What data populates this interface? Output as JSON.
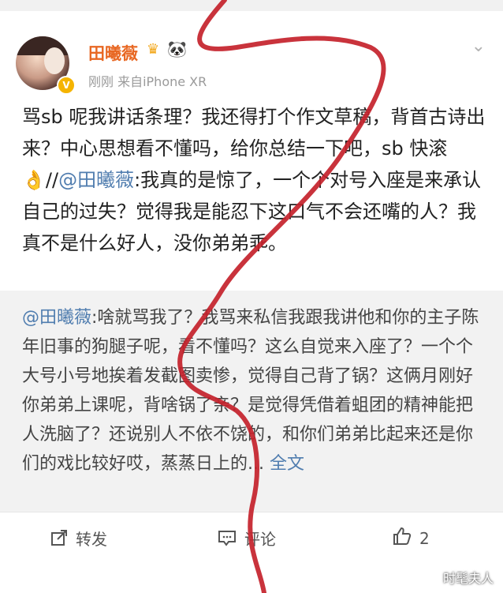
{
  "post": {
    "username": "田曦薇",
    "crown_icon": "crown-icon",
    "panda_icon": "panda-emoji",
    "meta": "刚刚 来自iPhone XR",
    "content_before": "骂sb 呢我讲话条理？我还得打个作文草稿，背首古诗出来？中心思想看不懂吗，给你总结一下吧，sb 快滚👌//",
    "content_mention": "@田曦薇",
    "content_after": ":我真的是惊了，一个个对号入座是来承认自己的过失？觉得我是能忍下这口气不会还嘴的人？我真不是什么好人，没你弟弟乖。"
  },
  "repost": {
    "mention": "@田曦薇",
    "text": ":啥就骂我了？我骂来私信我跟我讲他和你的主子陈年旧事的狗腿子呢，看不懂吗？这么自觉来入座了？一个个大号小号地挨着发截图卖惨，觉得自己背了锅？这俩月刚好你弟弟上课呢，背啥锅了亲？是觉得凭借着蛆团的精神能把人洗脑了？还说别人不依不饶的，和你们弟弟比起来还是你们的戏比较好哎，蒸蒸日上的...",
    "more_label": "全文"
  },
  "actions": {
    "repost_label": "转发",
    "comment_label": "评论",
    "like_count": "2"
  },
  "watermark": "时髦夫人",
  "colors": {
    "accent_orange": "#e86722",
    "link_blue": "#507daf",
    "scribble_red": "#c4222b"
  }
}
